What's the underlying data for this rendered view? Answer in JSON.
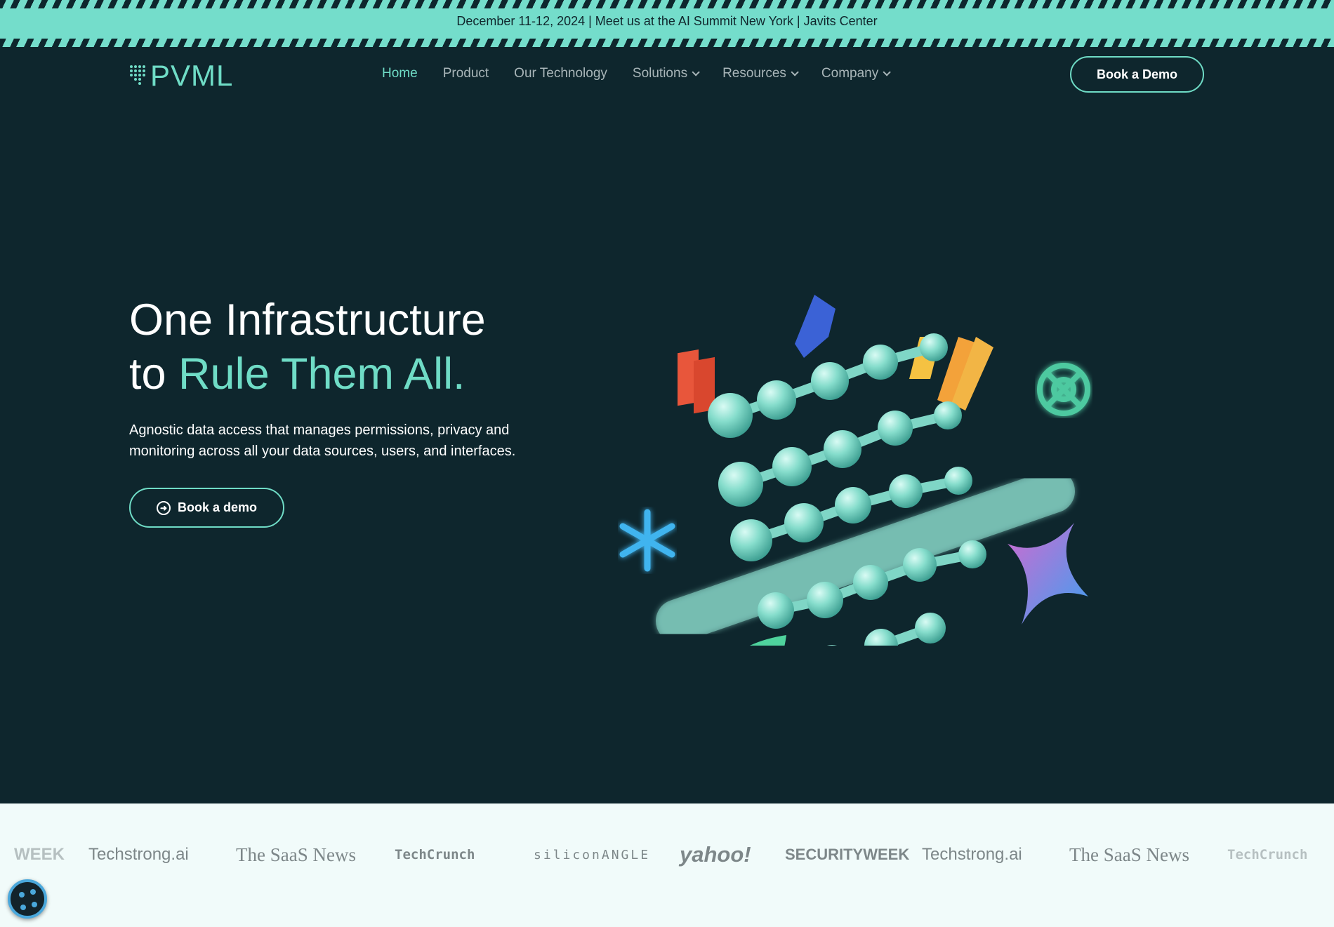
{
  "banner": {
    "text": "December 11-12, 2024 | Meet us at the AI Summit New York | Javits Center"
  },
  "header": {
    "logo": "PVML",
    "nav": [
      {
        "label": "Home",
        "active": true
      },
      {
        "label": "Product"
      },
      {
        "label": "Our Technology"
      },
      {
        "label": "Solutions",
        "dropdown": true
      },
      {
        "label": "Resources",
        "dropdown": true
      },
      {
        "label": "Company",
        "dropdown": true
      }
    ],
    "cta": "Book a Demo"
  },
  "hero": {
    "title_line1": "One Infrastructure",
    "title_line2_plain": "to ",
    "title_line2_accent": "Rule Them All.",
    "subtitle": "Agnostic data access that manages permissions, privacy and monitoring across all your data sources, users, and interfaces.",
    "cta": "Book a demo"
  },
  "press": {
    "logos": [
      "WEEK",
      "Techstrong.ai",
      "The SaaS News",
      "TechCrunch",
      "siliconANGLE",
      "yahoo!",
      "SECURITYWEEK",
      "Techstrong.ai",
      "The SaaS News",
      "TechCrunch"
    ]
  },
  "colors": {
    "accent": "#6fdcc6",
    "background": "#0e262d",
    "banner": "#74ddcb"
  }
}
